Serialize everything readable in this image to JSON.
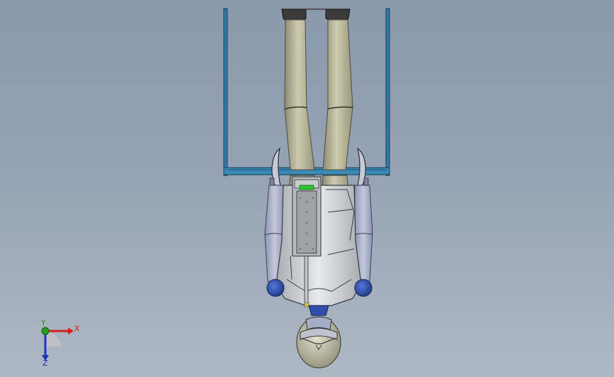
{
  "viewport": {
    "background_top": "#8a99ab",
    "background_bottom": "#aeb8c4"
  },
  "model": {
    "frame_color": "#2f7aa6",
    "leg_color": "#b9b59a",
    "torso_color": "#d3d6da",
    "shoulder_color": "#2f4fa8",
    "arm_color": "#a7adc6",
    "head_color": "#c8c5b2",
    "indicator_color": "#31c431"
  },
  "triad": {
    "x_label": "X",
    "y_label": "Y",
    "z_label": "Z",
    "x_color": "#d32020",
    "y_color": "#20a020",
    "z_color": "#2030c0"
  }
}
